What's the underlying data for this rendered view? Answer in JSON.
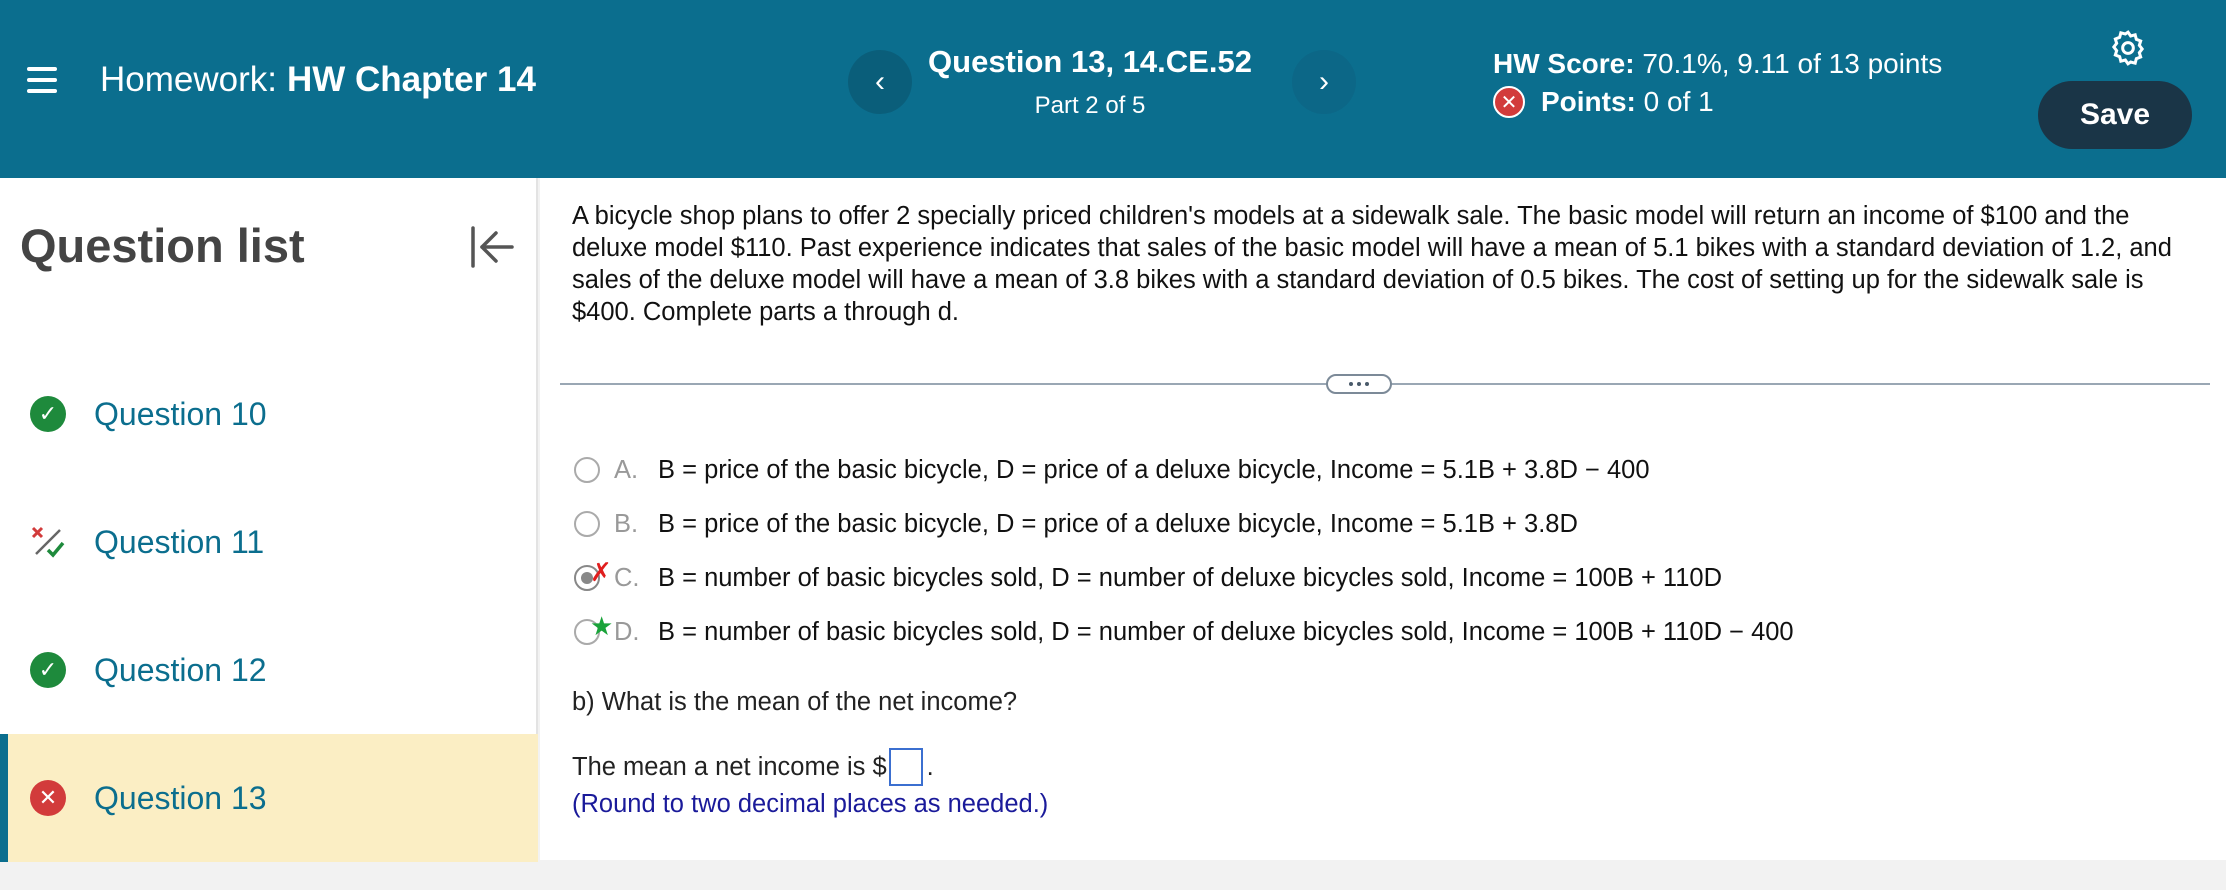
{
  "header": {
    "homework_label": "Homework:",
    "homework_name": "HW Chapter 14",
    "question_title": "Question 13, 14.CE.52",
    "question_part": "Part 2 of 5",
    "prev_symbol": "‹",
    "next_symbol": "›",
    "score_label": "HW Score:",
    "score_value": "70.1%, 9.11 of 13 points",
    "points_label": "Points:",
    "points_value": "0 of 1",
    "save_label": "Save",
    "accent": "#0b6e8e"
  },
  "sidebar": {
    "title": "Question list",
    "items": [
      {
        "label": "Question 10",
        "status": "correct"
      },
      {
        "label": "Question 11",
        "status": "partial"
      },
      {
        "label": "Question 12",
        "status": "correct"
      },
      {
        "label": "Question 13",
        "status": "incorrect",
        "active": true
      }
    ]
  },
  "main": {
    "problem": "A bicycle shop plans to offer 2 specially priced children's models at a sidewalk sale. The basic model will return an income of $100 and the deluxe model $110. Past experience indicates that sales of the basic model will have a mean of 5.1 bikes with a standard deviation of 1.2, and sales of the deluxe model will have a mean of 3.8 bikes with a standard deviation of 0.5 bikes. The cost of setting up for the sidewalk sale is $400. Complete parts a through d.",
    "options": [
      {
        "letter": "A.",
        "text": "B = price of the basic bicycle, D = price of a deluxe bicycle, Income = 5.1B + 3.8D − 400"
      },
      {
        "letter": "B.",
        "text": "B = price of the basic bicycle, D = price of a deluxe bicycle, Income = 5.1B + 3.8D"
      },
      {
        "letter": "C.",
        "text": "B = number of basic bicycles sold, D = number of deluxe bicycles sold, Income = 100B + 110D"
      },
      {
        "letter": "D.",
        "text": "B = number of basic bicycles sold, D = number of deluxe bicycles sold, Income = 100B + 110D − 400"
      }
    ],
    "part_b_question": "b) What is the mean of the net income?",
    "answer_prefix": "The mean a net income is $",
    "answer_suffix": ".",
    "answer_value": "",
    "hint": "(Round to two decimal places as needed.)"
  }
}
